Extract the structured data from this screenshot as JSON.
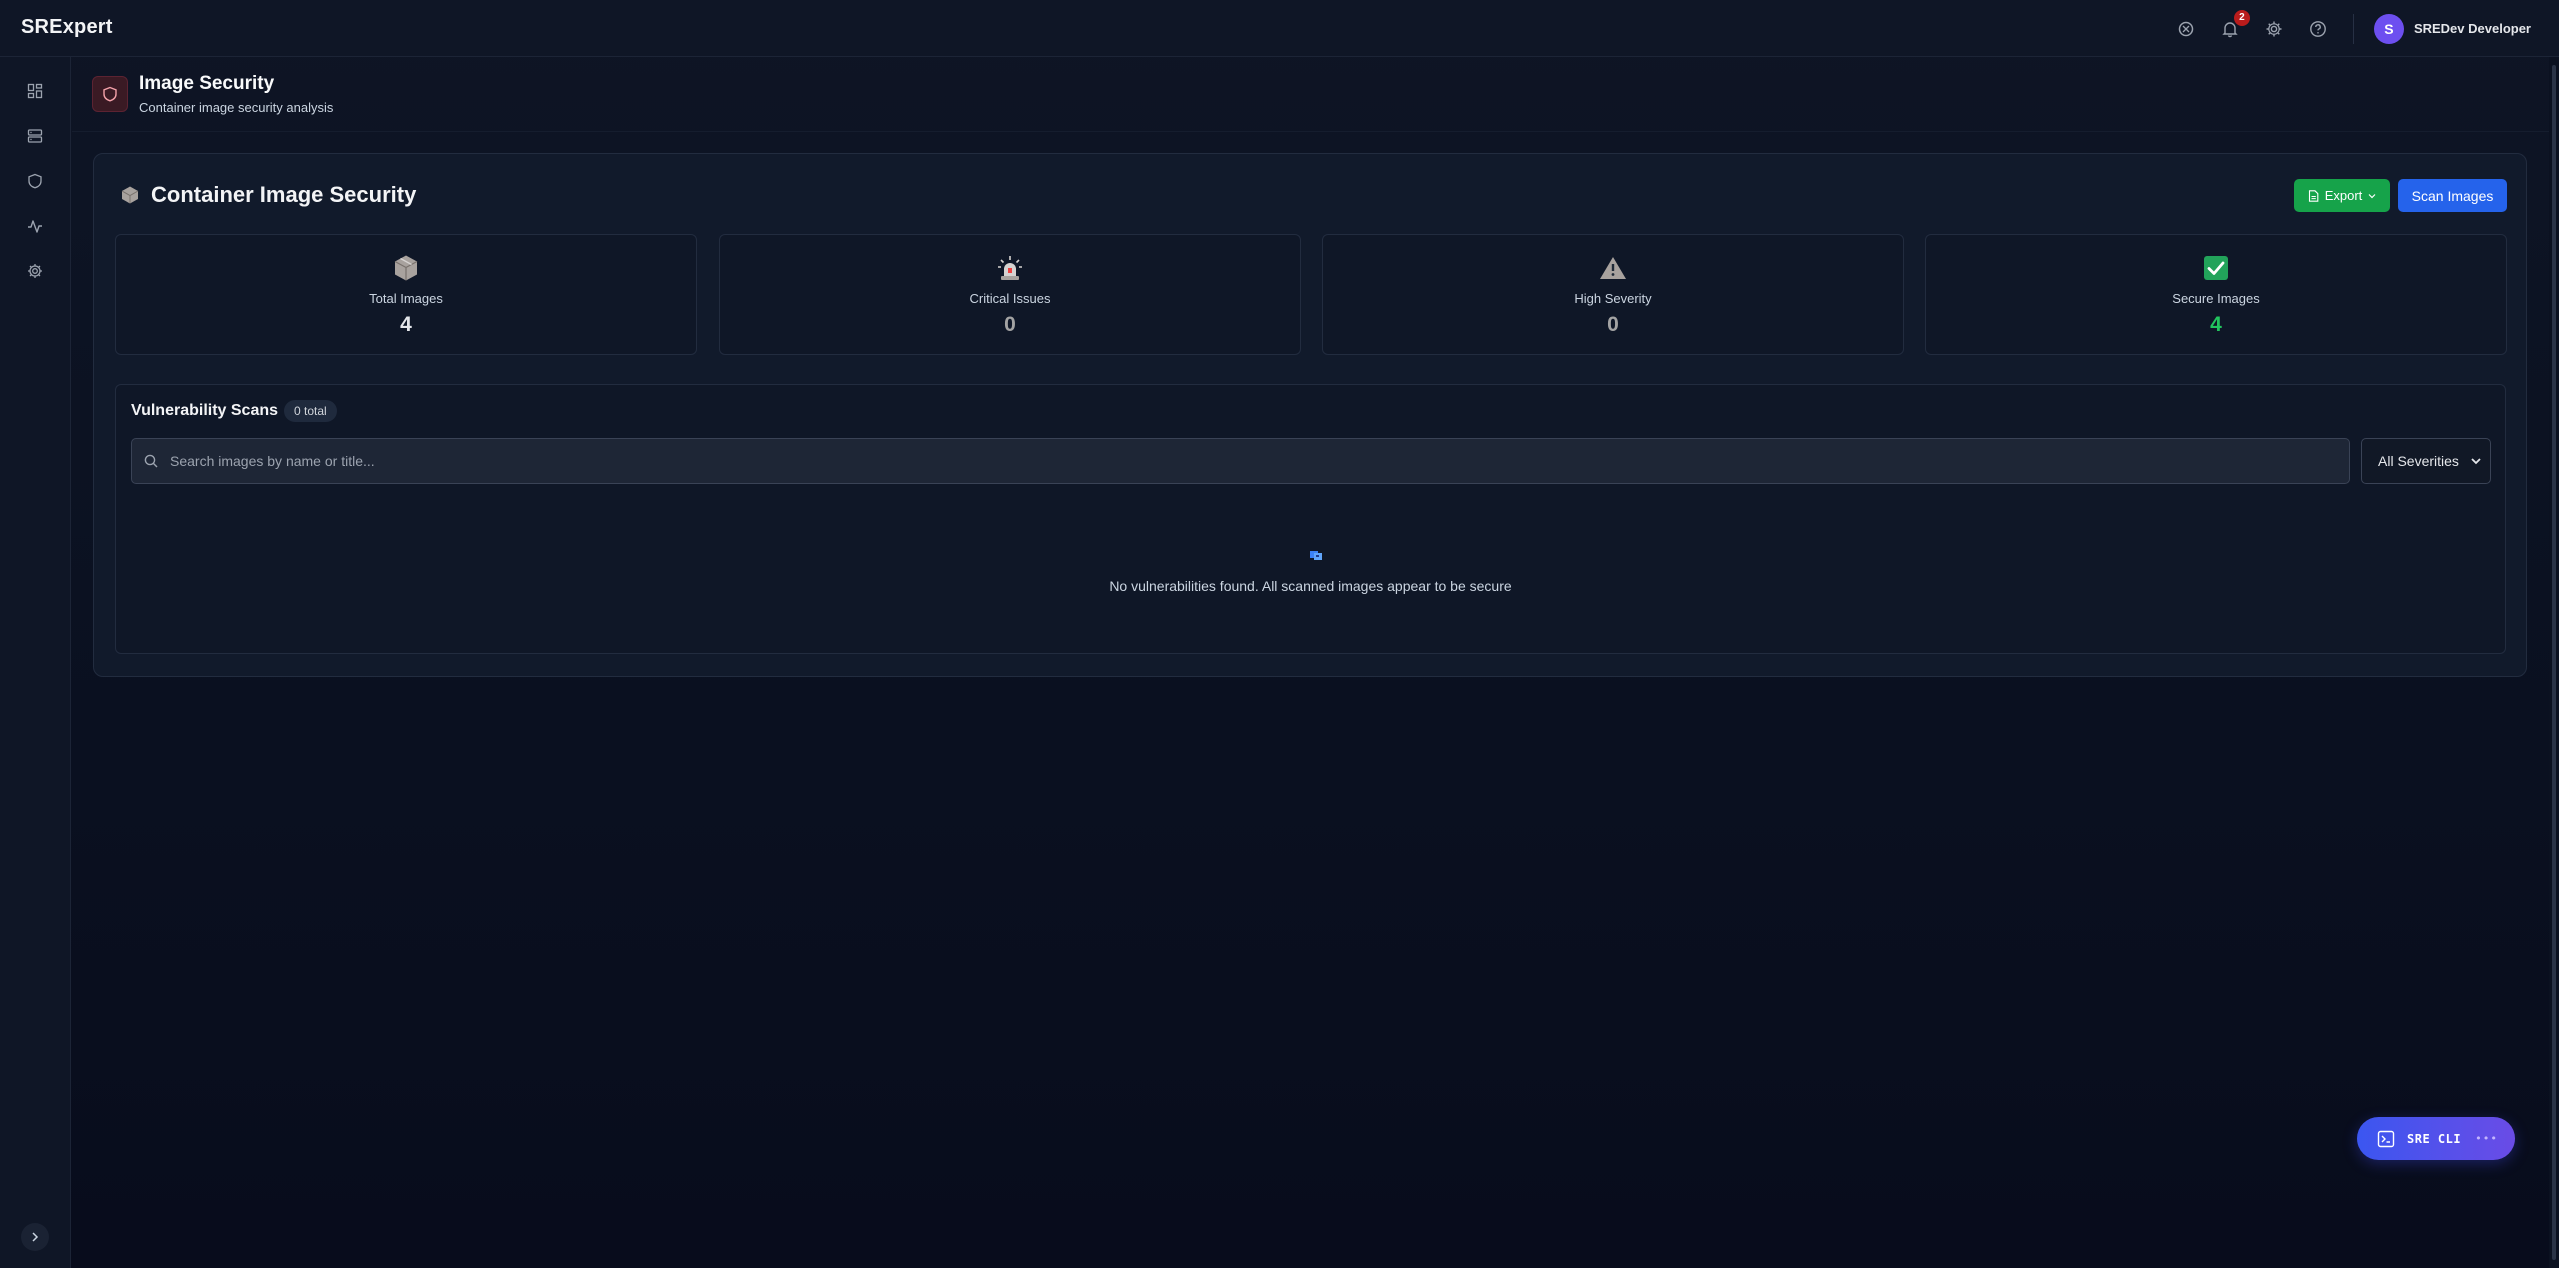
{
  "app": {
    "brand": "SRExpert"
  },
  "topbar": {
    "notifications_count": "2",
    "user": {
      "initial": "S",
      "name": "SREDev Developer"
    }
  },
  "sidebar": {
    "items": [
      {
        "icon": "dashboard-icon"
      },
      {
        "icon": "server-icon"
      },
      {
        "icon": "shield-icon"
      },
      {
        "icon": "activity-icon"
      },
      {
        "icon": "gear-icon"
      }
    ]
  },
  "header": {
    "title": "Image Security",
    "subtitle": "Container image security analysis"
  },
  "card": {
    "title": "Container Image Security",
    "export_label": "Export",
    "scan_label": "Scan Images",
    "stats": [
      {
        "label": "Total Images",
        "value": "4",
        "icon": "package-icon"
      },
      {
        "label": "Critical Issues",
        "value": "0",
        "icon": "siren-icon"
      },
      {
        "label": "High Severity",
        "value": "0",
        "icon": "warning-icon"
      },
      {
        "label": "Secure Images",
        "value": "4",
        "icon": "check-icon"
      }
    ]
  },
  "vuln": {
    "title": "Vulnerability Scans",
    "count_badge": "0 total",
    "search_placeholder": "Search images by name or title...",
    "severity_selected": "All Severities",
    "empty_message": "No vulnerabilities found. All scanned images appear to be secure"
  },
  "cli": {
    "label": "SRE CLI",
    "dots": "•••"
  },
  "colors": {
    "accent": "#2563eb",
    "success": "#16a34a",
    "danger": "#b91c1c",
    "purple": "#6d4ff0"
  }
}
